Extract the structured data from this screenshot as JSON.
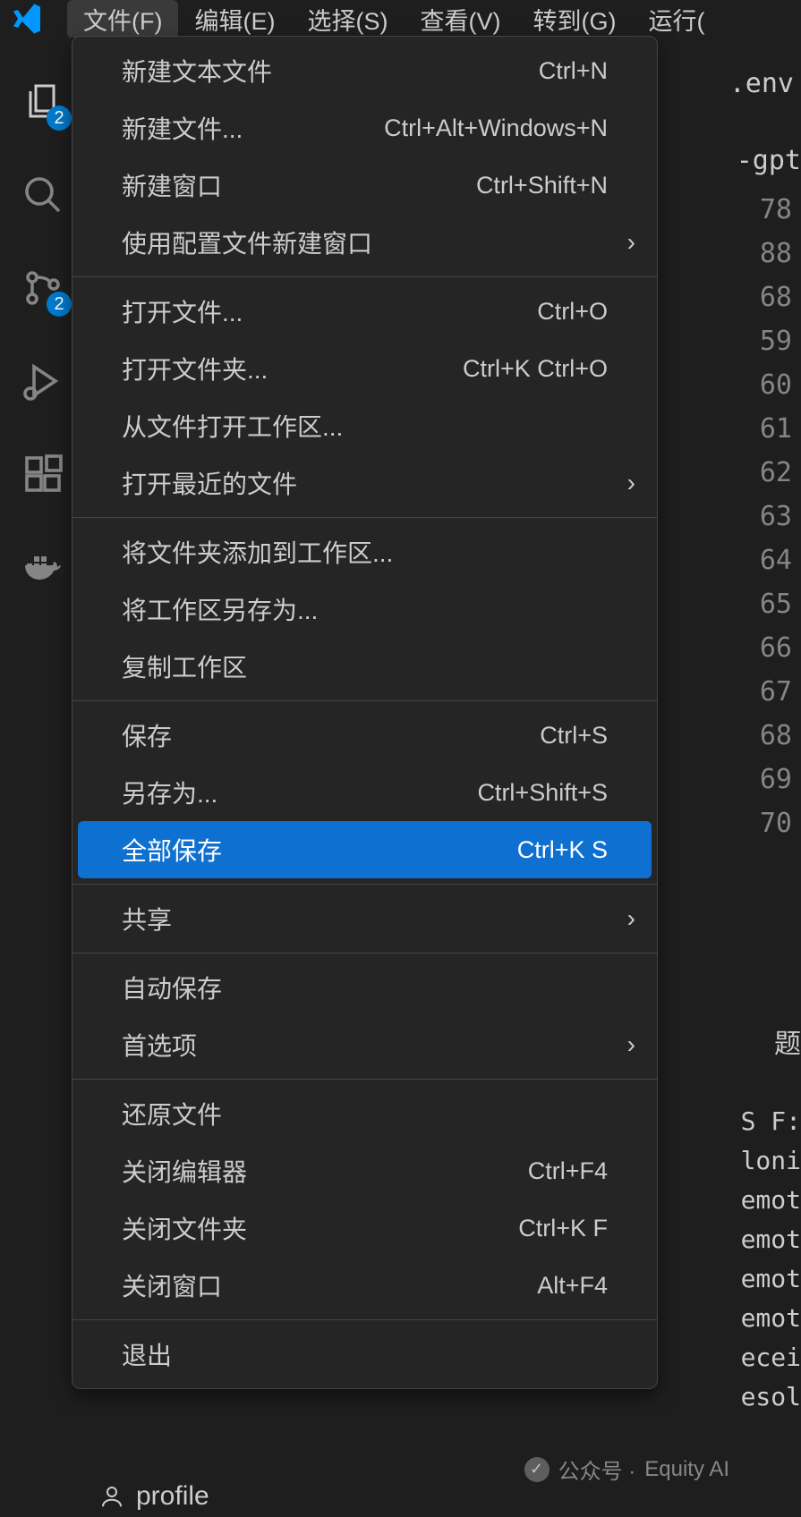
{
  "menubar": {
    "items": [
      "文件(F)",
      "编辑(E)",
      "选择(S)",
      "查看(V)",
      "转到(G)",
      "运行("
    ]
  },
  "activitybar": {
    "explorer_badge": "2",
    "scm_badge": "2"
  },
  "file_menu": {
    "groups": [
      [
        {
          "label": "新建文本文件",
          "shortcut": "Ctrl+N"
        },
        {
          "label": "新建文件...",
          "shortcut": "Ctrl+Alt+Windows+N"
        },
        {
          "label": "新建窗口",
          "shortcut": "Ctrl+Shift+N"
        },
        {
          "label": "使用配置文件新建窗口",
          "submenu": true
        }
      ],
      [
        {
          "label": "打开文件...",
          "shortcut": "Ctrl+O"
        },
        {
          "label": "打开文件夹...",
          "shortcut": "Ctrl+K Ctrl+O"
        },
        {
          "label": "从文件打开工作区..."
        },
        {
          "label": "打开最近的文件",
          "submenu": true
        }
      ],
      [
        {
          "label": "将文件夹添加到工作区..."
        },
        {
          "label": "将工作区另存为..."
        },
        {
          "label": "复制工作区"
        }
      ],
      [
        {
          "label": "保存",
          "shortcut": "Ctrl+S"
        },
        {
          "label": "另存为...",
          "shortcut": "Ctrl+Shift+S"
        },
        {
          "label": "全部保存",
          "shortcut": "Ctrl+K S",
          "highlight": true
        }
      ],
      [
        {
          "label": "共享",
          "submenu": true
        }
      ],
      [
        {
          "label": "自动保存"
        },
        {
          "label": "首选项",
          "submenu": true
        }
      ],
      [
        {
          "label": "还原文件"
        },
        {
          "label": "关闭编辑器",
          "shortcut": "Ctrl+F4"
        },
        {
          "label": "关闭文件夹",
          "shortcut": "Ctrl+K F"
        },
        {
          "label": "关闭窗口",
          "shortcut": "Alt+F4"
        }
      ],
      [
        {
          "label": "退出"
        }
      ]
    ]
  },
  "editor": {
    "tab_fragment": ".env",
    "code_fragment": "-gpt",
    "line_numbers": [
      "78",
      "88",
      "68",
      "59",
      "60",
      "61",
      "62",
      "63",
      "64",
      "65",
      "66",
      "67",
      "68",
      "69",
      "70"
    ],
    "panel_fragment": "题",
    "terminal_lines": [
      "S F:",
      "loni",
      "emot",
      "emot",
      "emot",
      "emot",
      "ecei",
      "esol"
    ]
  },
  "statusbar": {
    "item": "profile"
  },
  "watermark": {
    "prefix": "公众号 ·",
    "name": "Equity AI"
  }
}
